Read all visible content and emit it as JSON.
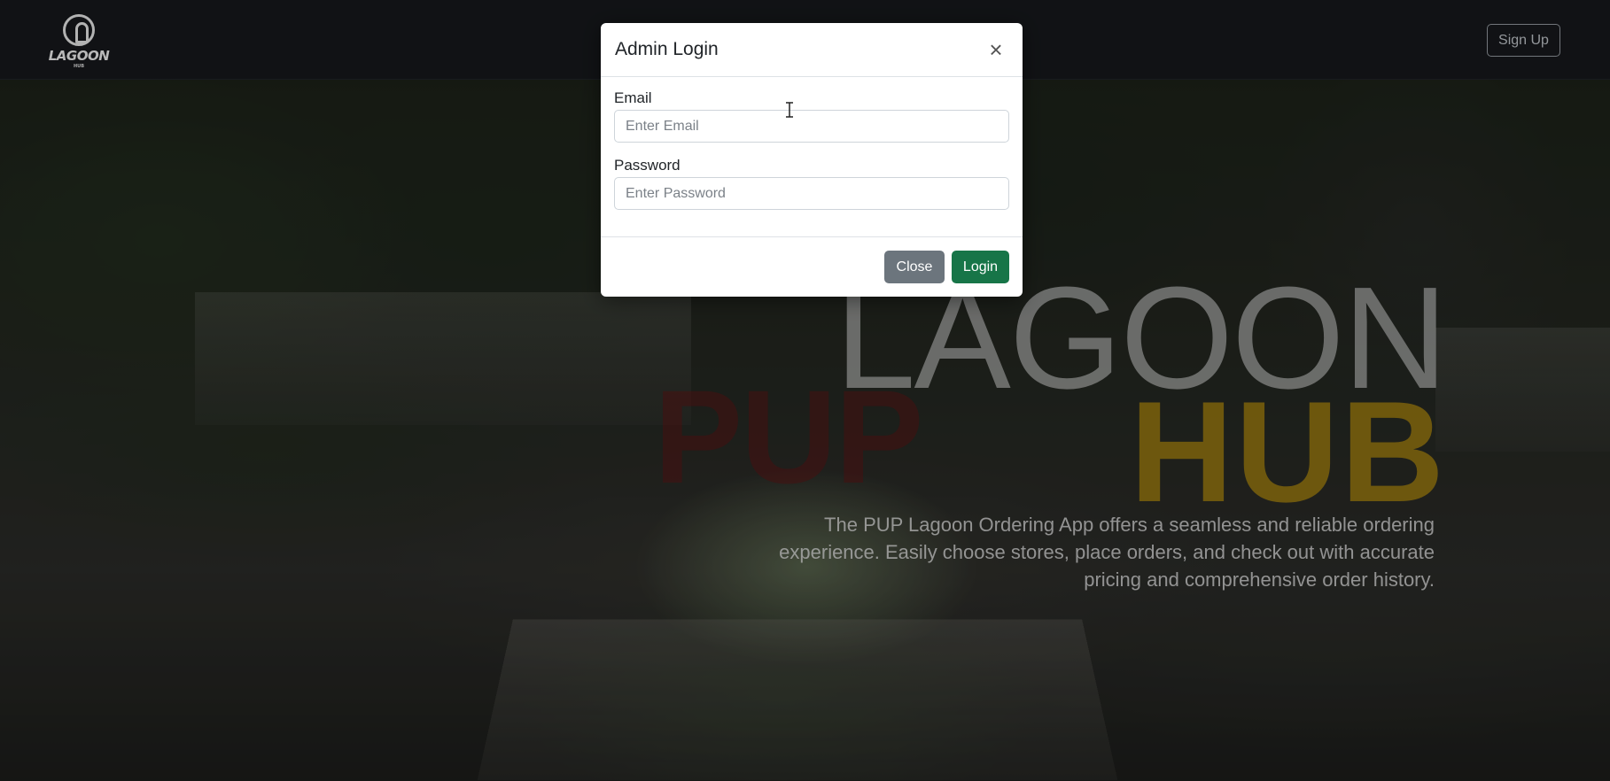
{
  "navbar": {
    "logo_text": "LAGOON",
    "logo_sub": "HUB",
    "signup_label": "Sign Up"
  },
  "hero": {
    "title_lagoon": "LAGOON",
    "title_pup": "PUP",
    "title_hub": "HUB",
    "description": "The PUP Lagoon Ordering App offers a seamless and reliable ordering experience. Easily choose stores, place orders, and check out with accurate pricing and comprehensive order history."
  },
  "modal": {
    "title": "Admin Login",
    "close_icon": "×",
    "email_label": "Email",
    "email_placeholder": "Enter Email",
    "email_value": "",
    "password_label": "Password",
    "password_placeholder": "Enter Password",
    "password_value": "",
    "close_button": "Close",
    "login_button": "Login"
  },
  "colors": {
    "login_button": "#177548",
    "close_button": "#6c757d",
    "hub_title": "#96780f",
    "navbar_bg": "#15171a"
  },
  "icons": [
    "close-icon",
    "text-cursor-icon",
    "logo-icon"
  ]
}
